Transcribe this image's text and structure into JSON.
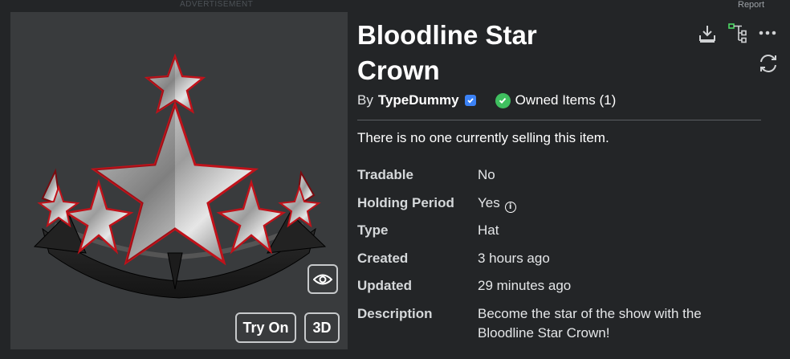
{
  "header": {
    "advertisement": "ADVERTISEMENT",
    "report": "Report"
  },
  "thumbnail": {
    "alt": "Bloodline Star Crown",
    "try_on_label": "Try On",
    "three_d_label": "3D"
  },
  "item": {
    "title_line1": "Bloodline Star",
    "title_line2": "Crown",
    "by_label": "By",
    "creator": "TypeDummy",
    "owned_label": "Owned Items (1)",
    "sale_status": "There is no one currently selling this item."
  },
  "details": [
    {
      "label": "Tradable",
      "value": "No"
    },
    {
      "label": "Holding Period",
      "value": "Yes"
    },
    {
      "label": "Type",
      "value": "Hat"
    },
    {
      "label": "Created",
      "value": "3 hours ago"
    },
    {
      "label": "Updated",
      "value": "29 minutes ago"
    },
    {
      "label": "Description",
      "value": "Become the star of the show with the Bloodline Star Crown!"
    }
  ],
  "icons": {
    "download": "download-icon",
    "tree": "hierarchy-icon",
    "more": "more-icon",
    "refresh": "refresh-icon",
    "eye": "eye-icon",
    "info": "info-icon",
    "verified": "verified-badge-icon",
    "owned": "checkmark-icon"
  },
  "colors": {
    "background": "#232527",
    "thumbnail_bg": "#393b3d",
    "verified": "#3b82f6",
    "owned": "#3fbf5f",
    "crown_accent": "#c0121a"
  }
}
